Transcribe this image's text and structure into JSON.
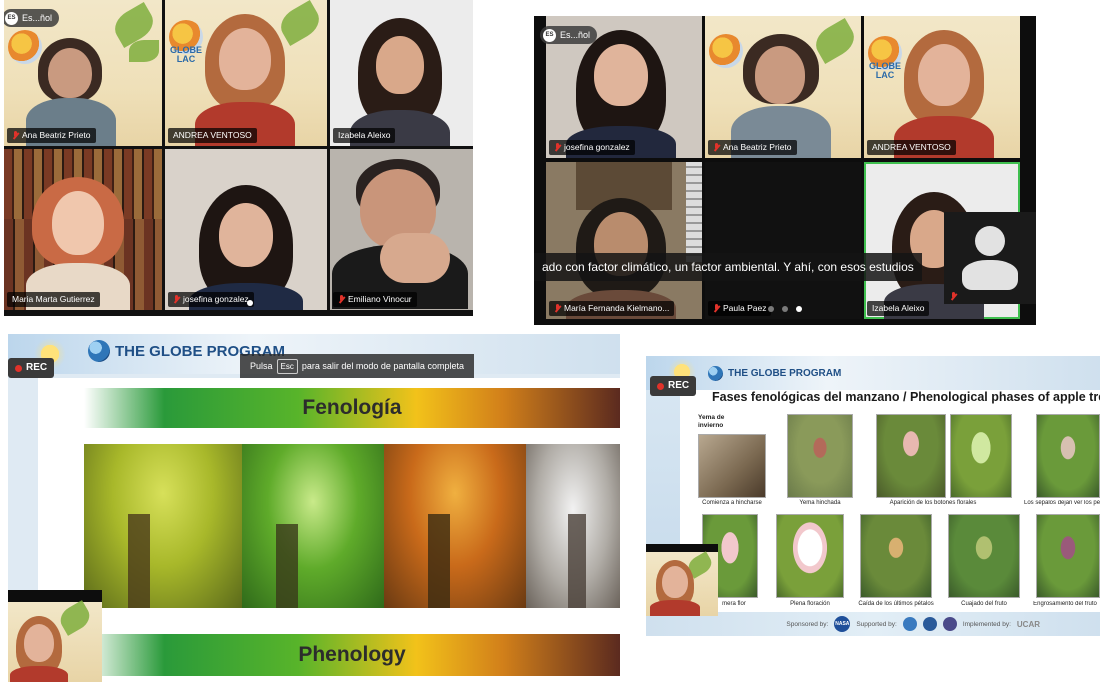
{
  "lang_badge": {
    "code": "ES",
    "label": "Es...ñol"
  },
  "call_1": {
    "participants": [
      {
        "name": "Ana Beatriz Prieto",
        "muted": true
      },
      {
        "name": "ANDREA VENTOSO",
        "muted": false,
        "speaking": true
      },
      {
        "name": "Izabela Aleixo",
        "muted": false
      },
      {
        "name": "Maria Marta Gutierrez",
        "muted": false
      },
      {
        "name": "josefina gonzalez",
        "muted": true
      },
      {
        "name": "Emiliano Vinocur",
        "muted": true
      }
    ]
  },
  "call_2": {
    "participants": [
      {
        "name": "josefina gonzalez",
        "muted": true
      },
      {
        "name": "Ana Beatriz Prieto",
        "muted": true
      },
      {
        "name": "ANDREA VENTOSO",
        "muted": false
      },
      {
        "name": "María Fernanda Kielmano...",
        "muted": true
      },
      {
        "name": "Paula Paez",
        "muted": true
      },
      {
        "name": "Izabela Aleixo",
        "muted": false,
        "speaking": true
      }
    ],
    "caption": "ado con factor climático, un factor ambiental. Y ahí, con esos estudios"
  },
  "slide_1": {
    "rec_label": "REC",
    "program": "THE GLOBE PROGRAM",
    "esc_hint": {
      "before": "Pulsa",
      "key": "Esc",
      "after": "para salir del modo de pantalla completa"
    },
    "title_top": "Fenología",
    "title_bottom": "Phenology"
  },
  "slide_2": {
    "rec_label": "REC",
    "program": "THE GLOBE PROGRAM",
    "title": "Fases fenológicas del manzano / Phenological phases of apple trees",
    "callout": "Yema de invierno",
    "phases_row1": [
      "Comienza a hincharse",
      "Yema hinchada",
      "Aparición de los botones florales",
      "Los sépalos dejan ver los péta"
    ],
    "phases_row2": [
      "mera flor",
      "Plena floración",
      "Caída de los últimos pétalos",
      "Cuajado del fruto",
      "Engrosamiento del fruto"
    ],
    "footer": {
      "sponsored": "Sponsored by:",
      "sponsor_1": "NASA",
      "supported": "Supported by:",
      "implemented": "Implemented by:",
      "implementer": "UCAR"
    }
  },
  "colors": {
    "speaking_border": "#3fbf4f",
    "muted_icon": "#e0322a",
    "globe_blue": "#1f4f86"
  }
}
